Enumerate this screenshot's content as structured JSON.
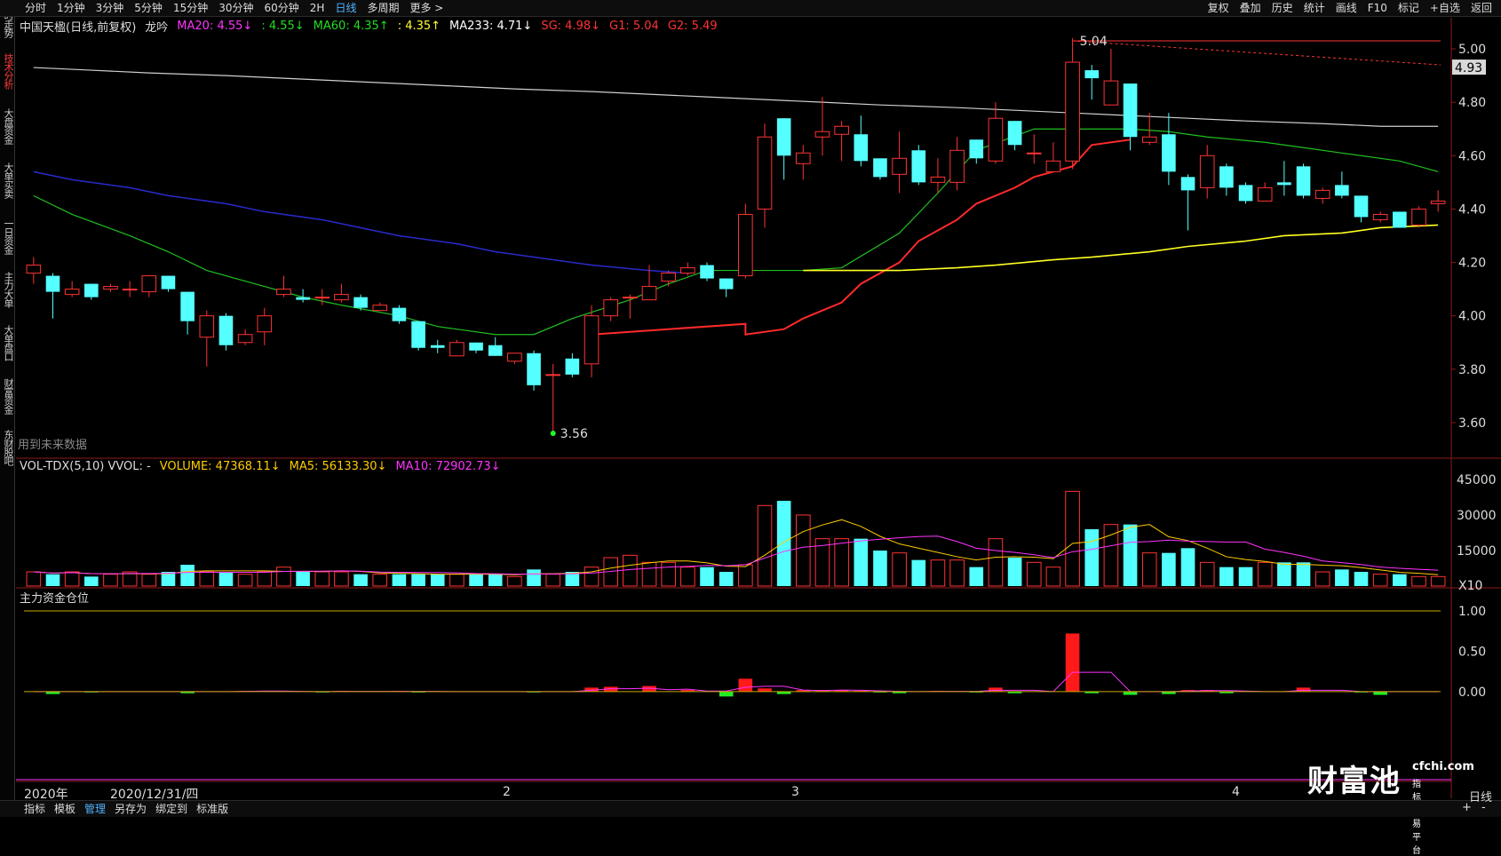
{
  "sidebar": {
    "items": [
      {
        "label": "分时走势",
        "active": false
      },
      {
        "label": "技术分析",
        "active": true
      },
      {
        "label": "大盘资金",
        "active": false
      },
      {
        "label": "大单买卖",
        "active": false
      },
      {
        "label": "一日资金",
        "active": false
      },
      {
        "label": "主力大单",
        "active": false
      },
      {
        "label": "大单盘口",
        "active": false
      },
      {
        "label": "财富资金",
        "active": false
      },
      {
        "label": "东财股吧",
        "active": false
      }
    ]
  },
  "topbar": {
    "timeframes": [
      "分时",
      "1分钟",
      "3分钟",
      "5分钟",
      "15分钟",
      "30分钟",
      "60分钟",
      "2H",
      "日线",
      "多周期",
      "更多 >"
    ],
    "active_timeframe": "日线",
    "tools": [
      "复权",
      "叠加",
      "历史",
      "统计",
      "画线",
      "F10",
      "标记",
      "+自选",
      "返回"
    ]
  },
  "main_header": {
    "title": "中国天楹(日线,前复权)",
    "indicator": "龙吟",
    "ma20": "MA20: 4.55↓",
    "extra1": ": 4.55↓",
    "ma60": "MA60: 4.35↑",
    "extra2": ": 4.35↑",
    "ma233": "MA233: 4.71↓",
    "sg": "SG: 4.98↓",
    "g1": "G1: 5.04",
    "g2": "G2: 5.49"
  },
  "main_chart": {
    "y_ticks": [
      "5.00",
      "4.80",
      "4.60",
      "4.40",
      "4.20",
      "4.00",
      "3.80",
      "3.60"
    ],
    "current_price": "4.93",
    "high_label": "5.04",
    "low_label": "3.56",
    "future_text": "用到未来数据"
  },
  "volume_header": {
    "name": "VOL-TDX(5,10) VVOL: -",
    "volume": "VOLUME: 47368.11↓",
    "ma5": "MA5: 56133.30↓",
    "ma10": "MA10: 72902.73↓"
  },
  "volume_axis": {
    "ticks": [
      "45000",
      "30000",
      "15000"
    ],
    "unit": "X10"
  },
  "fund_header": {
    "name": "主力资金仓位"
  },
  "fund_axis": {
    "ticks": [
      "1.00",
      "0.50",
      "0.00"
    ]
  },
  "dates": {
    "year": "2020年",
    "date": "2020/12/31/四",
    "months": [
      "2",
      "3",
      "4"
    ]
  },
  "bottombar": {
    "tabs": [
      "指标",
      "模板",
      "管理",
      "另存为",
      "绑定到",
      "标准版"
    ],
    "active": "管理",
    "period": "日线",
    "plus": "+",
    "minus": "-"
  },
  "watermark": {
    "brand": "财富池",
    "site": "cfchi.com",
    "sub": "指标交易平台"
  },
  "colors": {
    "up": "#ff3333",
    "down": "#54ffff",
    "ma20": "#ff2a2a",
    "ma60": "#ffff22",
    "ma233": "#d0d0d0",
    "blue_line": "#2a2acc",
    "green_line": "#20c020"
  },
  "chart_data": {
    "type": "candlestick",
    "title": "中国天楹(日线,前复权)",
    "ylim": [
      3.5,
      5.05
    ],
    "candles": [
      {
        "o": 4.16,
        "c": 4.19,
        "h": 4.22,
        "l": 4.12
      },
      {
        "o": 4.15,
        "c": 4.09,
        "h": 4.16,
        "l": 3.99
      },
      {
        "o": 4.08,
        "c": 4.1,
        "h": 4.13,
        "l": 4.07
      },
      {
        "o": 4.12,
        "c": 4.07,
        "h": 4.12,
        "l": 4.06
      },
      {
        "o": 4.1,
        "c": 4.11,
        "h": 4.12,
        "l": 4.09
      },
      {
        "o": 4.1,
        "c": 4.1,
        "h": 4.13,
        "l": 4.07
      },
      {
        "o": 4.09,
        "c": 4.15,
        "h": 4.15,
        "l": 4.07
      },
      {
        "o": 4.15,
        "c": 4.1,
        "h": 4.15,
        "l": 4.09
      },
      {
        "o": 4.09,
        "c": 3.98,
        "h": 4.09,
        "l": 3.93
      },
      {
        "o": 3.92,
        "c": 4.0,
        "h": 4.02,
        "l": 3.81
      },
      {
        "o": 4.0,
        "c": 3.89,
        "h": 4.01,
        "l": 3.87
      },
      {
        "o": 3.9,
        "c": 3.93,
        "h": 3.95,
        "l": 3.89
      },
      {
        "o": 3.94,
        "c": 4.0,
        "h": 4.03,
        "l": 3.89
      },
      {
        "o": 4.08,
        "c": 4.1,
        "h": 4.15,
        "l": 4.07
      },
      {
        "o": 4.07,
        "c": 4.06,
        "h": 4.1,
        "l": 4.05
      },
      {
        "o": 4.07,
        "c": 4.07,
        "h": 4.1,
        "l": 4.04
      },
      {
        "o": 4.06,
        "c": 4.08,
        "h": 4.12,
        "l": 4.05
      },
      {
        "o": 4.07,
        "c": 4.03,
        "h": 4.08,
        "l": 4.02
      },
      {
        "o": 4.02,
        "c": 4.04,
        "h": 4.05,
        "l": 4.02
      },
      {
        "o": 4.03,
        "c": 3.98,
        "h": 4.04,
        "l": 3.97
      },
      {
        "o": 3.98,
        "c": 3.88,
        "h": 3.98,
        "l": 3.87
      },
      {
        "o": 3.89,
        "c": 3.88,
        "h": 3.91,
        "l": 3.86
      },
      {
        "o": 3.85,
        "c": 3.9,
        "h": 3.91,
        "l": 3.85
      },
      {
        "o": 3.9,
        "c": 3.87,
        "h": 3.9,
        "l": 3.86
      },
      {
        "o": 3.89,
        "c": 3.85,
        "h": 3.92,
        "l": 3.85
      },
      {
        "o": 3.83,
        "c": 3.86,
        "h": 3.86,
        "l": 3.82
      },
      {
        "o": 3.86,
        "c": 3.74,
        "h": 3.87,
        "l": 3.72
      },
      {
        "o": 3.78,
        "c": 3.78,
        "h": 3.82,
        "l": 3.56
      },
      {
        "o": 3.84,
        "c": 3.78,
        "h": 3.86,
        "l": 3.77
      },
      {
        "o": 3.82,
        "c": 4.0,
        "h": 4.04,
        "l": 3.77
      },
      {
        "o": 4.0,
        "c": 4.06,
        "h": 4.07,
        "l": 3.98
      },
      {
        "o": 4.07,
        "c": 4.07,
        "h": 4.08,
        "l": 3.99
      },
      {
        "o": 4.06,
        "c": 4.11,
        "h": 4.19,
        "l": 4.06
      },
      {
        "o": 4.13,
        "c": 4.16,
        "h": 4.17,
        "l": 4.11
      },
      {
        "o": 4.16,
        "c": 4.18,
        "h": 4.2,
        "l": 4.15
      },
      {
        "o": 4.19,
        "c": 4.14,
        "h": 4.2,
        "l": 4.13
      },
      {
        "o": 4.14,
        "c": 4.1,
        "h": 4.14,
        "l": 4.07
      },
      {
        "o": 4.15,
        "c": 4.38,
        "h": 4.42,
        "l": 4.14
      },
      {
        "o": 4.4,
        "c": 4.67,
        "h": 4.72,
        "l": 4.33
      },
      {
        "o": 4.74,
        "c": 4.6,
        "h": 4.74,
        "l": 4.51
      },
      {
        "o": 4.57,
        "c": 4.61,
        "h": 4.64,
        "l": 4.51
      },
      {
        "o": 4.67,
        "c": 4.69,
        "h": 4.82,
        "l": 4.6
      },
      {
        "o": 4.68,
        "c": 4.71,
        "h": 4.73,
        "l": 4.58
      },
      {
        "o": 4.68,
        "c": 4.58,
        "h": 4.75,
        "l": 4.56
      },
      {
        "o": 4.59,
        "c": 4.52,
        "h": 4.59,
        "l": 4.51
      },
      {
        "o": 4.53,
        "c": 4.59,
        "h": 4.69,
        "l": 4.46
      },
      {
        "o": 4.62,
        "c": 4.5,
        "h": 4.64,
        "l": 4.49
      },
      {
        "o": 4.5,
        "c": 4.52,
        "h": 4.59,
        "l": 4.46
      },
      {
        "o": 4.5,
        "c": 4.62,
        "h": 4.67,
        "l": 4.47
      },
      {
        "o": 4.66,
        "c": 4.59,
        "h": 4.66,
        "l": 4.57
      },
      {
        "o": 4.58,
        "c": 4.74,
        "h": 4.8,
        "l": 4.57
      },
      {
        "o": 4.73,
        "c": 4.64,
        "h": 4.73,
        "l": 4.62
      },
      {
        "o": 4.61,
        "c": 4.61,
        "h": 4.68,
        "l": 4.57
      },
      {
        "o": 4.54,
        "c": 4.58,
        "h": 4.65,
        "l": 4.54
      },
      {
        "o": 4.58,
        "c": 4.95,
        "h": 5.04,
        "l": 4.55
      },
      {
        "o": 4.92,
        "c": 4.89,
        "h": 4.94,
        "l": 4.81
      },
      {
        "o": 4.79,
        "c": 4.88,
        "h": 5.0,
        "l": 4.79
      },
      {
        "o": 4.87,
        "c": 4.67,
        "h": 4.87,
        "l": 4.62
      },
      {
        "o": 4.65,
        "c": 4.67,
        "h": 4.76,
        "l": 4.64
      },
      {
        "o": 4.68,
        "c": 4.54,
        "h": 4.76,
        "l": 4.49
      },
      {
        "o": 4.52,
        "c": 4.47,
        "h": 4.53,
        "l": 4.32
      },
      {
        "o": 4.48,
        "c": 4.6,
        "h": 4.64,
        "l": 4.44
      },
      {
        "o": 4.56,
        "c": 4.48,
        "h": 4.57,
        "l": 4.45
      },
      {
        "o": 4.49,
        "c": 4.43,
        "h": 4.5,
        "l": 4.42
      },
      {
        "o": 4.43,
        "c": 4.48,
        "h": 4.5,
        "l": 4.43
      },
      {
        "o": 4.5,
        "c": 4.49,
        "h": 4.58,
        "l": 4.45
      },
      {
        "o": 4.56,
        "c": 4.45,
        "h": 4.57,
        "l": 4.44
      },
      {
        "o": 4.44,
        "c": 4.47,
        "h": 4.48,
        "l": 4.42
      },
      {
        "o": 4.49,
        "c": 4.45,
        "h": 4.54,
        "l": 4.44
      },
      {
        "o": 4.45,
        "c": 4.37,
        "h": 4.45,
        "l": 4.35
      },
      {
        "o": 4.36,
        "c": 4.38,
        "h": 4.39,
        "l": 4.35
      },
      {
        "o": 4.39,
        "c": 4.33,
        "h": 4.39,
        "l": 4.33
      },
      {
        "o": 4.34,
        "c": 4.4,
        "h": 4.41,
        "l": 4.33
      },
      {
        "o": 4.42,
        "c": 4.43,
        "h": 4.47,
        "l": 4.39
      }
    ],
    "ma233": [
      4.93,
      4.92,
      4.91,
      4.9,
      4.89,
      4.88,
      4.87,
      4.86,
      4.85,
      4.84,
      4.83,
      4.82,
      4.81,
      4.8,
      4.79,
      4.78,
      4.77,
      4.76,
      4.75,
      4.74,
      4.73,
      4.72,
      4.71,
      4.71
    ],
    "volume": [
      6,
      5,
      6,
      4,
      5,
      6,
      5,
      6,
      9,
      6,
      6,
      5,
      6,
      8,
      6,
      6,
      6,
      5,
      5,
      5,
      5,
      5,
      5,
      5,
      5,
      4,
      7,
      5,
      6,
      8,
      12,
      13,
      10,
      10,
      8,
      8,
      6,
      9,
      34,
      36,
      30,
      20,
      20,
      20,
      15,
      14,
      11,
      11,
      11,
      8,
      20,
      12,
      10,
      8,
      40,
      24,
      26,
      26,
      14,
      14,
      16,
      10,
      8,
      8,
      10,
      10,
      10,
      6,
      7,
      6,
      5,
      5,
      4,
      4
    ],
    "fund": [
      0,
      -0.03,
      0,
      -0.01,
      0,
      0,
      0,
      0,
      -0.02,
      0,
      0,
      0.01,
      0.01,
      0,
      0,
      -0.01,
      0.01,
      0,
      0,
      0.01,
      -0.01,
      0,
      0,
      0,
      0,
      0,
      -0.01,
      0,
      0,
      0.05,
      0.06,
      0,
      0.07,
      0,
      0.02,
      0,
      -0.06,
      0.16,
      0.04,
      -0.03,
      0.02,
      0.02,
      0.02,
      0.01,
      -0.01,
      -0.02,
      0,
      0.01,
      0,
      -0.01,
      0.05,
      -0.02,
      0,
      0,
      0.72,
      -0.02,
      0,
      -0.04,
      0,
      -0.03,
      0.02,
      0.02,
      -0.02,
      0,
      0,
      0,
      0.05,
      0,
      0,
      -0.01,
      -0.04,
      0,
      0,
      0
    ]
  }
}
